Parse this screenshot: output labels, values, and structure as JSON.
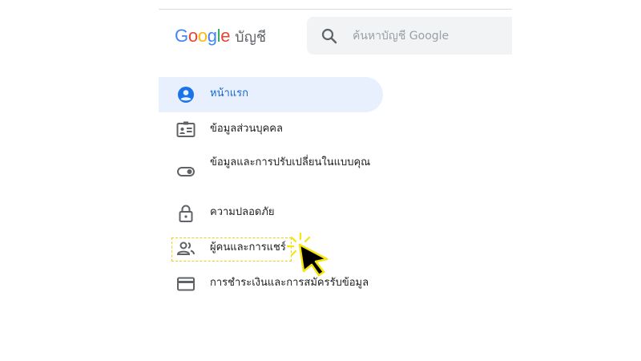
{
  "header": {
    "logo_text": "Google",
    "product_name": "บัญชี",
    "logo_colors": [
      "#4285f4",
      "#ea4335",
      "#fbbc05",
      "#4285f4",
      "#34a853",
      "#ea4335"
    ]
  },
  "search": {
    "placeholder": "ค้นหาบัญชี Google",
    "value": "",
    "icon": "search-icon"
  },
  "sidebar": {
    "items": [
      {
        "label": "หน้าแรก",
        "icon": "account-circle-icon",
        "active": true
      },
      {
        "label": "ข้อมูลส่วนบุคคล",
        "icon": "badge-icon",
        "active": false
      },
      {
        "label": "ข้อมูลและการปรับเปลี่ยนในแบบคุณ",
        "icon": "toggle-icon",
        "active": false
      },
      {
        "label": "ความปลอดภัย",
        "icon": "lock-icon",
        "active": false
      },
      {
        "label": "ผู้คนและการแชร์",
        "icon": "people-icon",
        "active": false,
        "highlighted": true
      },
      {
        "label": "การชำระเงินและการสมัครรับข้อมูล",
        "icon": "credit-card-icon",
        "active": false
      }
    ]
  },
  "colors": {
    "active_bg": "#e8f0fe",
    "active_text": "#1967d2",
    "icon_gray": "#5f6368",
    "highlight": "#e8d31a",
    "cursor_fill": "#000000"
  }
}
